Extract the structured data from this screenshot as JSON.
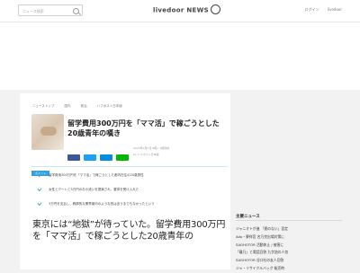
{
  "header": {
    "search_placeholder": "ニュース検索",
    "logo_text": "livedoor NEWS",
    "nav": [
      "ログイン",
      "livedoor"
    ]
  },
  "article": {
    "breadcrumbs": [
      "ニューストップ",
      "国内",
      "政治",
      "ハフポスト日本版"
    ],
    "headline": "留学費用300万円を「ママ活」で稼ごうとした20歳青年の嘆き",
    "meta": [
      "2023年2月5日 8時 / 1時間前",
      "by ハフポスト日本版"
    ],
    "tag_label": "ポイント",
    "points": [
      "留学費用300万円を「ママ活」で稼ごうとした都内在住の20歳男性",
      "女性とデートと5万円のお小遣いを提案され、要求を受け入れた",
      "3万円を支払し、教師的な業界案内のような形は言うまでもなかったという"
    ],
    "body": "東京には“地獄”が待っていた。留学費用300万円を「ママ活」で稼ごうとした20歳青年の"
  },
  "sidebar": {
    "title": "主要ニュース",
    "items": [
      "ジャニオトが進 「運のない」否定",
      "Ado・夢祥宮 名乃完出場対策に",
      "SAGHOTOR 活動休止 / 被害に",
      "「離乃」と電話回答 九字詰の人気",
      "SAGHOTOR 谷口社の友人回答",
      "ジャ・リサイクルバッグ 販売時"
    ]
  },
  "colors": {
    "accent": "#36a1e0",
    "facebook": "#3b5998",
    "twitter": "#1da1f2",
    "hatena": "#008fde",
    "line": "#00b900"
  }
}
